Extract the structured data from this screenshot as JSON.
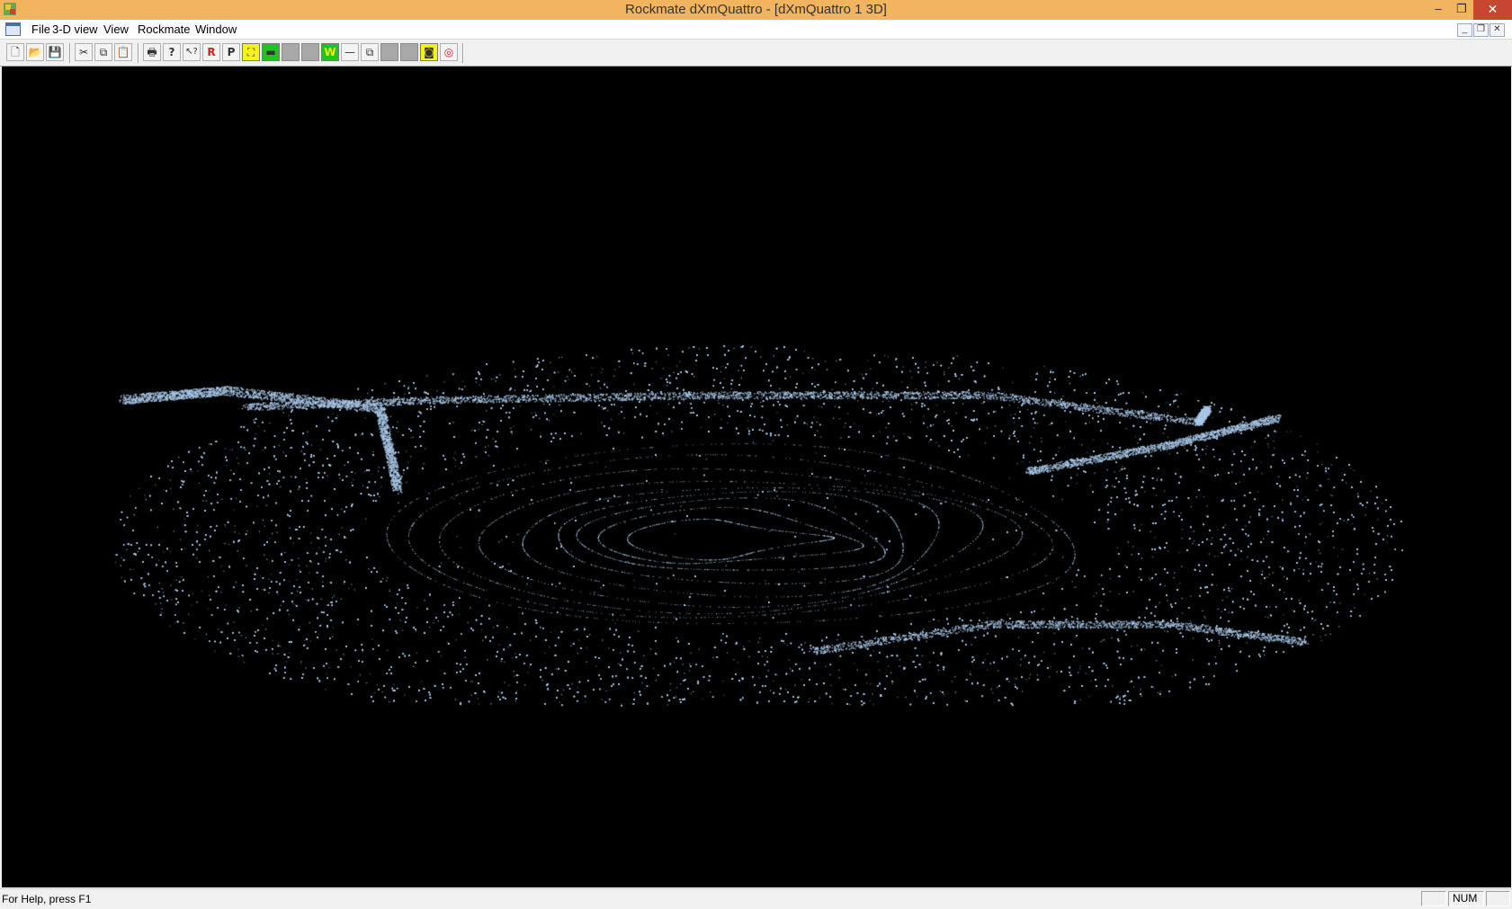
{
  "window": {
    "title": "Rockmate dXmQuattro - [dXmQuattro 1 3D]",
    "minimize": "–",
    "restore": "❐",
    "close": "✕"
  },
  "menu": {
    "items": [
      "File",
      "3-D view",
      "View",
      "Rockmate",
      "Window"
    ]
  },
  "mdi": {
    "minimize": "_",
    "restore": "❐",
    "close": "✕"
  },
  "toolbar": {
    "buttons": [
      {
        "name": "new-icon",
        "glyph": "🗋"
      },
      {
        "name": "open-icon",
        "glyph": "📂"
      },
      {
        "name": "save-icon",
        "glyph": "💾"
      },
      {
        "name": "cut-icon",
        "glyph": "✂"
      },
      {
        "name": "copy-icon",
        "glyph": "⧉"
      },
      {
        "name": "paste-icon",
        "glyph": "📋"
      },
      {
        "name": "print-icon",
        "glyph": "🖶"
      },
      {
        "name": "about-icon",
        "glyph": "?"
      },
      {
        "name": "context-help-icon",
        "glyph": "↖?"
      },
      {
        "name": "r-button",
        "glyph": "R"
      },
      {
        "name": "p-button",
        "glyph": "P"
      },
      {
        "name": "yellow-tool-icon",
        "glyph": "⛶"
      },
      {
        "name": "green-tool-icon",
        "glyph": "▬"
      },
      {
        "name": "gray-tool-1",
        "glyph": ""
      },
      {
        "name": "gray-tool-2",
        "glyph": ""
      },
      {
        "name": "w-button",
        "glyph": "W"
      },
      {
        "name": "line-tool-icon",
        "glyph": "—"
      },
      {
        "name": "cube-icon",
        "glyph": "⧉"
      },
      {
        "name": "gray-tool-3",
        "glyph": ""
      },
      {
        "name": "gray-tool-4",
        "glyph": ""
      },
      {
        "name": "camera-icon",
        "glyph": "◙"
      },
      {
        "name": "target-icon",
        "glyph": "◎"
      }
    ]
  },
  "viewport": {
    "background": "#000000",
    "point_color": "#a8c8e8"
  },
  "status": {
    "help_text": "For Help, press F1",
    "num": "NUM"
  }
}
